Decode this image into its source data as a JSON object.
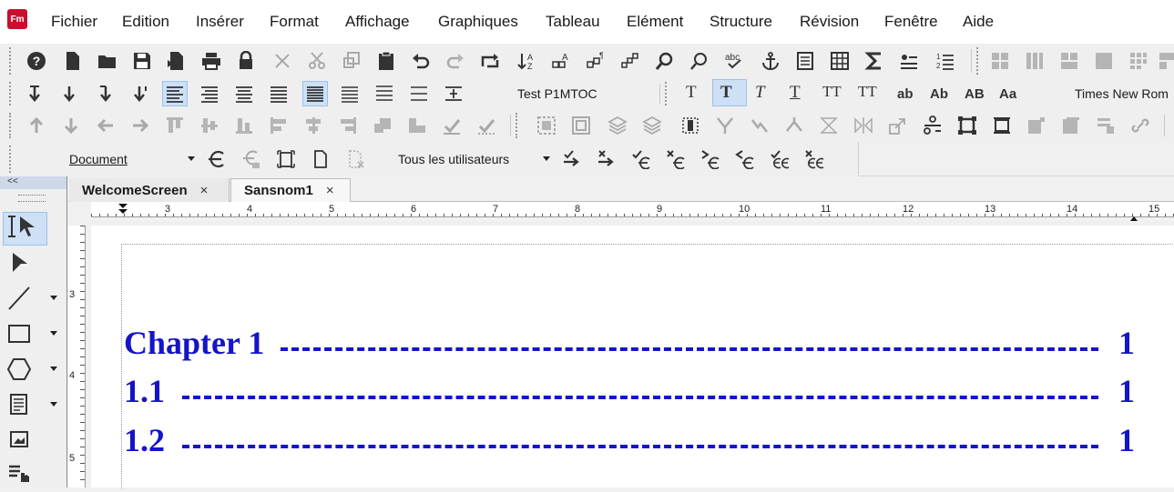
{
  "app": {
    "logo_text": "Fm"
  },
  "menu": [
    "Fichier",
    "Edition",
    "Insérer",
    "Format",
    "Affichage",
    "Graphiques",
    "Tableau",
    "Elément",
    "Structure",
    "Révision",
    "Fenêtre",
    "Aide"
  ],
  "toolbar": {
    "paragraph_tag": "Test P1MTOC",
    "font_family": "Times New Rom",
    "char_format_buttons": [
      "T",
      "T",
      "T",
      "T",
      "TT",
      "TT",
      "ab",
      "Ab",
      "AB",
      "Aa"
    ],
    "tracking_scope": "Document",
    "user_filter": "Tous les utilisateurs"
  },
  "palette": {
    "collapse": "<<"
  },
  "tabs": [
    {
      "label": "WelcomeScreen",
      "close": "×"
    },
    {
      "label": "Sansnom1",
      "close": "×"
    }
  ],
  "ruler": {
    "h_marks": [
      "3",
      "4",
      "5",
      "6",
      "7",
      "8",
      "9",
      "10",
      "11",
      "12",
      "13",
      "14",
      "15"
    ],
    "v_marks": [
      "3",
      "4",
      "5"
    ]
  },
  "toc": [
    {
      "label": "Chapter 1",
      "page": "1"
    },
    {
      "label": "1.1",
      "page": "1"
    },
    {
      "label": "1.2",
      "page": "1"
    }
  ]
}
